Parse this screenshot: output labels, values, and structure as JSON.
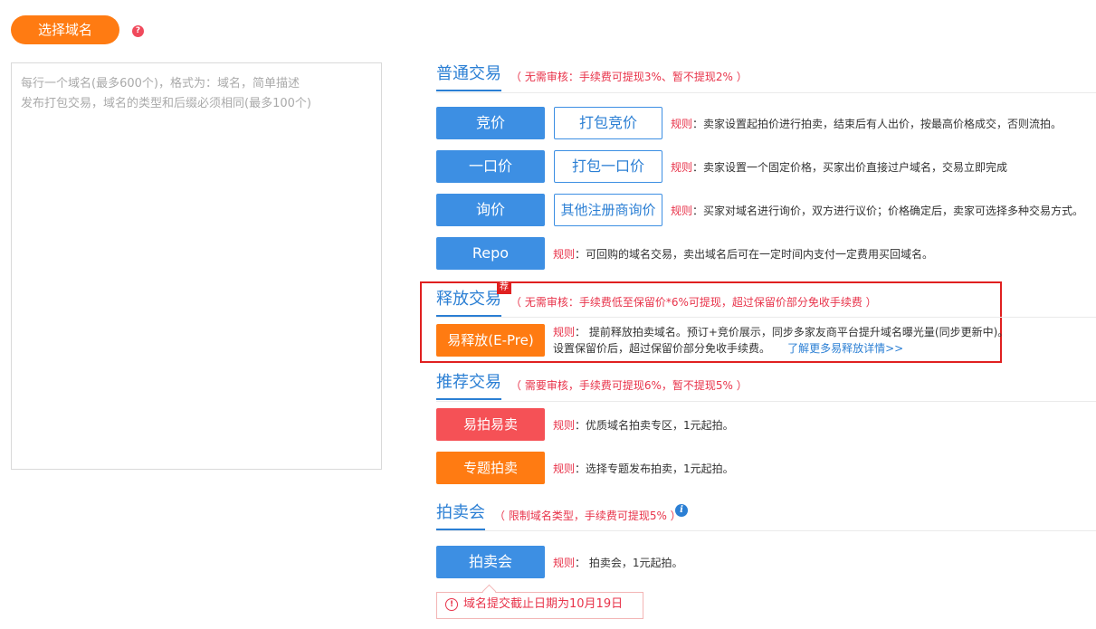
{
  "header": {
    "choose_domain_label": "选择域名",
    "help_icon": "question-icon"
  },
  "domain_input": {
    "placeholder": "每行一个域名(最多600个)，格式为：域名，简单描述\n发布打包交易，域名的类型和后缀必须相同(最多100个)"
  },
  "sections": {
    "normal": {
      "title": "普通交易",
      "note": "（ 无需审核：手续费可提现3%、暂不提现2% ）",
      "rows": [
        {
          "primary": "竞价",
          "secondary": "打包竞价",
          "rule_key": "规则",
          "rule_text": "：卖家设置起拍价进行拍卖，结束后有人出价，按最高价格成交，否则流拍。"
        },
        {
          "primary": "一口价",
          "secondary": "打包一口价",
          "rule_key": "规则",
          "rule_text": "：卖家设置一个固定价格，买家出价直接过户域名，交易立即完成"
        },
        {
          "primary": "询价",
          "secondary": "其他注册商询价",
          "rule_key": "规则",
          "rule_text": "：买家对域名进行询价，双方进行议价；价格确定后，卖家可选择多种交易方式。"
        },
        {
          "primary": "Repo",
          "rule_key": "规则",
          "rule_text": "：可回购的域名交易，卖出域名后可在一定时间内支付一定费用买回域名。"
        }
      ]
    },
    "release": {
      "title": "释放交易",
      "new_tag": "荐",
      "note": "（ 无需审核：手续费低至保留价*6%可提现，超过保留价部分免收手续费 ）",
      "button": "易释放(E-Pre)",
      "rule_key": "规则",
      "rule_line1": "： 提前释放拍卖域名。预订+竞价展示，同步多家友商平台提升域名曝光量(同步更新中)。",
      "rule_line2": "设置保留价后，超过保留价部分免收手续费。",
      "link": "了解更多易释放详情>>"
    },
    "recommend": {
      "title": "推荐交易",
      "note": "（ 需要审核，手续费可提现6%，暂不提现5% ）",
      "rows": [
        {
          "button": "易拍易卖",
          "rule_key": "规则",
          "rule_text": "：优质域名拍卖专区，1元起拍。"
        },
        {
          "button": "专题拍卖",
          "rule_key": "规则",
          "rule_text": "：选择专题发布拍卖，1元起拍。"
        }
      ]
    },
    "auction": {
      "title": "拍卖会",
      "note": "（ 限制域名类型，手续费可提现5% ）",
      "info_icon": "info-icon",
      "button": "拍卖会",
      "rule_key": "规则",
      "rule_text": "： 拍卖会，1元起拍。",
      "notice": "域名提交截止日期为10月19日"
    }
  },
  "colors": {
    "orange": "#ff7b12",
    "blue": "#3d8fe3",
    "red": "#f55156",
    "accent_text": "#e8334a"
  }
}
